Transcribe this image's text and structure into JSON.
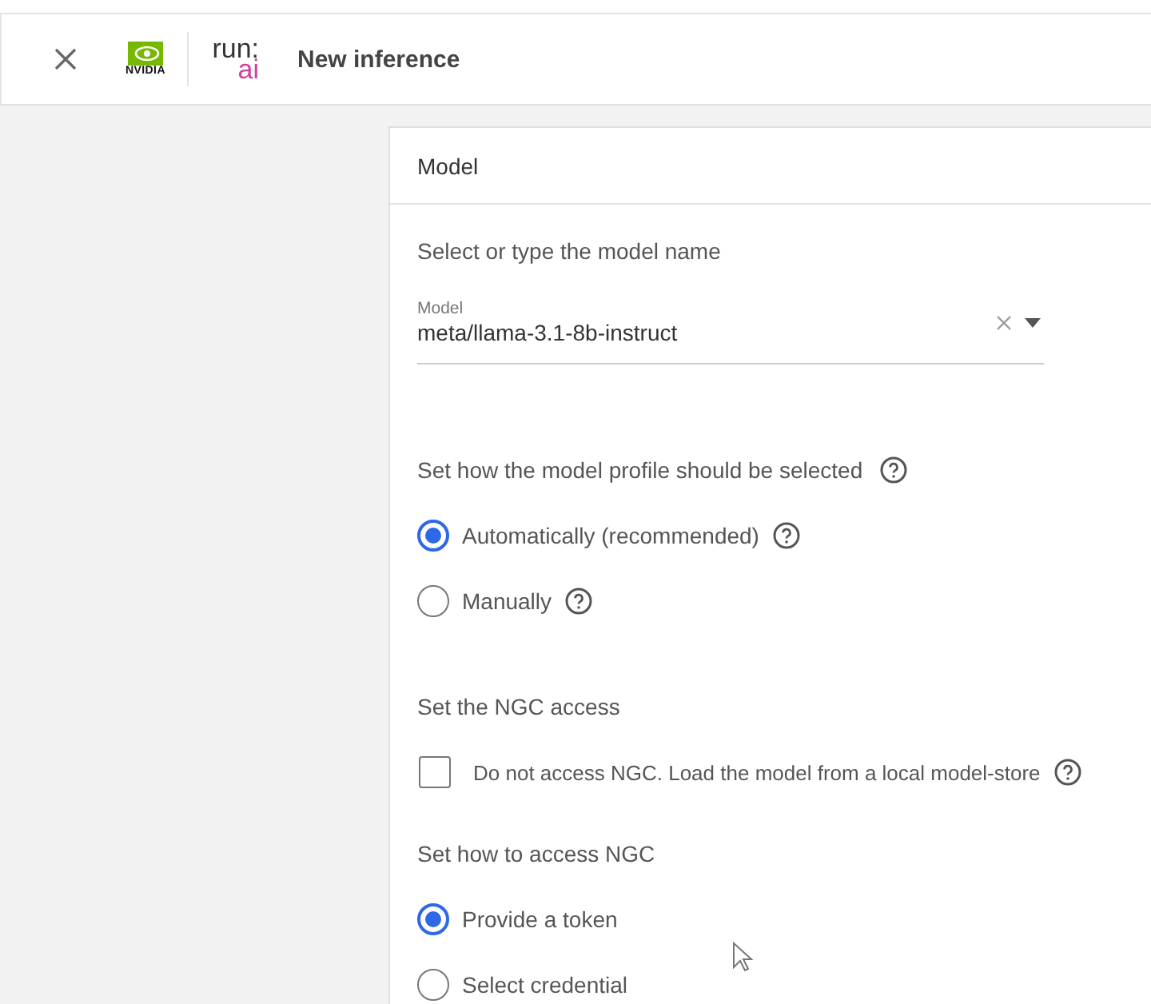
{
  "header": {
    "logo": {
      "nvidia": "NVIDIA",
      "run": "run:",
      "ai": "ai"
    },
    "title": "New inference"
  },
  "card": {
    "title": "Model",
    "sections": [
      {
        "label": "Select or type the model name",
        "help": false,
        "kind": "select",
        "field": {
          "label": "Model",
          "value": "meta/llama-3.1-8b-instruct"
        }
      },
      {
        "label": "Set how the model profile should be selected",
        "help": true,
        "kind": "radio",
        "options": [
          {
            "label": "Automatically (recommended)",
            "selected": true,
            "help": true
          },
          {
            "label": "Manually",
            "selected": false,
            "help": true
          }
        ]
      },
      {
        "label": "Set the NGC access",
        "help": false,
        "kind": "checkbox",
        "options": [
          {
            "label": "Do not access NGC. Load the model from a local model-store",
            "checked": false,
            "help": true
          }
        ]
      },
      {
        "label": "Set how to access NGC",
        "help": false,
        "kind": "radio",
        "options": [
          {
            "label": "Provide a token",
            "selected": true,
            "help": false
          },
          {
            "label": "Select credential",
            "selected": false,
            "help": false
          }
        ]
      }
    ]
  }
}
